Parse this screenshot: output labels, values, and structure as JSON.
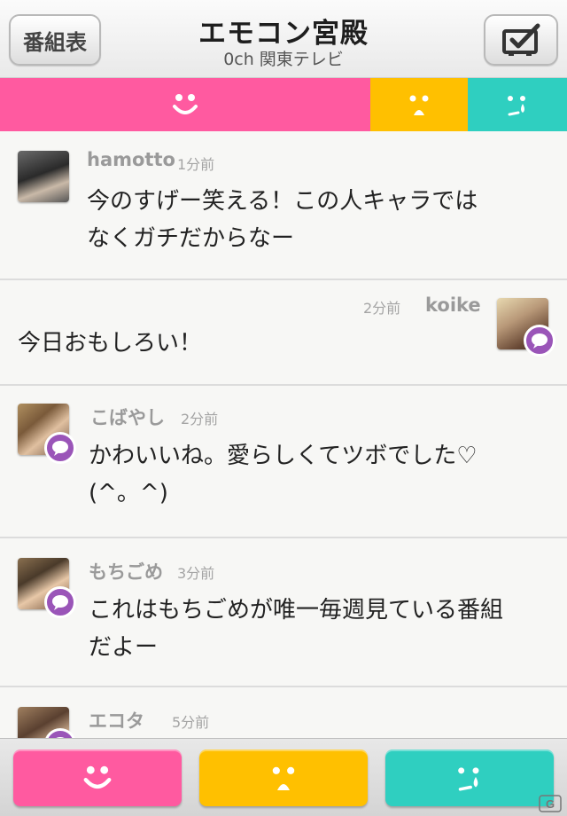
{
  "colors": {
    "happy": "#ff5aa0",
    "shock": "#ffc000",
    "sad": "#2fcfc0",
    "badge": "#9a55b8"
  },
  "header": {
    "left_button_label": "番組表",
    "title": "エモコン宮殿",
    "subtitle": "0ch 関東テレビ",
    "right_button_icon": "tv-check-icon"
  },
  "emotion_ratio": {
    "happy": 0.653,
    "shock": 0.172,
    "sad": 0.175
  },
  "posts": [
    {
      "user": "hamotto",
      "time": "1分前",
      "line1": "今のすげー笑える！この人キャラでは",
      "line2": "なくガチだからなー",
      "side": "left",
      "badge": false
    },
    {
      "user": "koike",
      "time": "2分前",
      "line1": "今日おもしろい！",
      "line2": "",
      "side": "right",
      "badge": true
    },
    {
      "user": "こばやし",
      "time": "2分前",
      "line1": "かわいいね。愛らしくてツボでした♡",
      "line2": "(^。^)",
      "side": "left",
      "badge": true
    },
    {
      "user": "もちごめ",
      "time": "3分前",
      "line1": "これはもちごめが唯一毎週見ている番組",
      "line2": "だよー",
      "side": "left",
      "badge": true
    },
    {
      "user": "エコタ",
      "time": "5分前",
      "line1": "",
      "line2": "",
      "side": "left",
      "badge": true
    }
  ],
  "footer": {
    "buttons": [
      "smile-face-icon",
      "shocked-face-icon",
      "crying-face-icon"
    ]
  },
  "watermark": "G"
}
